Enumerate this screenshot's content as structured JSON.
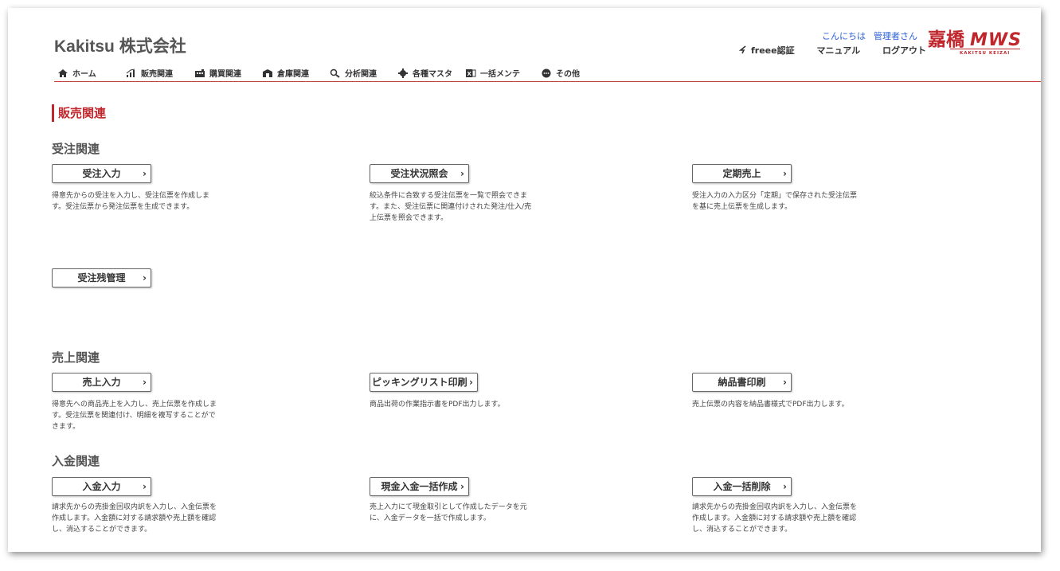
{
  "header": {
    "company": "Kakitsu 株式会社",
    "greeting": "こんにちは",
    "user": "管理者さん",
    "freee_label": "freee認証",
    "manual_label": "マニュアル",
    "logout_label": "ログアウト",
    "logo_text": "嘉橋 MWS",
    "logo_sub": "KAKITSU KEIZAI"
  },
  "nav": {
    "items": [
      {
        "label": "ホーム",
        "icon": "home-icon"
      },
      {
        "label": "販売関連",
        "icon": "bar-chart-icon"
      },
      {
        "label": "購買関連",
        "icon": "building-icon"
      },
      {
        "label": "倉庫関連",
        "icon": "warehouse-icon"
      },
      {
        "label": "分析関連",
        "icon": "analysis-icon"
      },
      {
        "label": "各種マスタ",
        "icon": "gear-icon"
      },
      {
        "label": "一括メンテ",
        "icon": "excel-icon"
      },
      {
        "label": "その他",
        "icon": "more-icon"
      }
    ]
  },
  "page": {
    "section_title": "販売関連",
    "groups": [
      {
        "title": "受注関連",
        "items": [
          {
            "label": "受注入力",
            "desc": "得意先からの受注を入力し、受注伝票を作成しま\nす。受注伝票から発注伝票を生成できます。"
          },
          {
            "label": "受注状況照会",
            "desc": "絞込条件に合致する受注伝票を一覧で照会できま\nす。また、受注伝票に関連付けされた発注/仕入/売\n上伝票を照会できます。"
          },
          {
            "label": "定期売上",
            "desc": "受注入力の入力区分「定期」で保存された受注伝票\nを基に売上伝票を生成します。"
          },
          {
            "label": "受注残管理",
            "desc": ""
          }
        ]
      },
      {
        "title": "売上関連",
        "items": [
          {
            "label": "売上入力",
            "desc": "得意先への商品売上を入力し、売上伝票を作成しま\nす。受注伝票を関連付け、明細を複写することがで\nきます。"
          },
          {
            "label": "ピッキングリスト印刷",
            "desc": "商品出荷の作業指示書をPDF出力します。"
          },
          {
            "label": "納品書印刷",
            "desc": "売上伝票の内容を納品書様式でPDF出力します。"
          }
        ]
      },
      {
        "title": "入金関連",
        "items": [
          {
            "label": "入金入力",
            "desc": "請求先からの売掛金回収内訳を入力し、入金伝票を\n作成します。入金額に対する請求額や売上額を確認\nし、消込することができます。"
          },
          {
            "label": "現金入金一括作成",
            "desc": "売上入力にて現金取引として作成したデータを元\nに、入金データを一括で作成します。"
          },
          {
            "label": "入金一括削除",
            "desc": "請求先からの売掛金回収内訳を入力し、入金伝票を\n作成します。入金額に対する請求額や売上額を確認\nし、消込することができます。"
          }
        ]
      }
    ]
  },
  "colors": {
    "accent": "#c0272d",
    "link": "#2b5fd9"
  }
}
